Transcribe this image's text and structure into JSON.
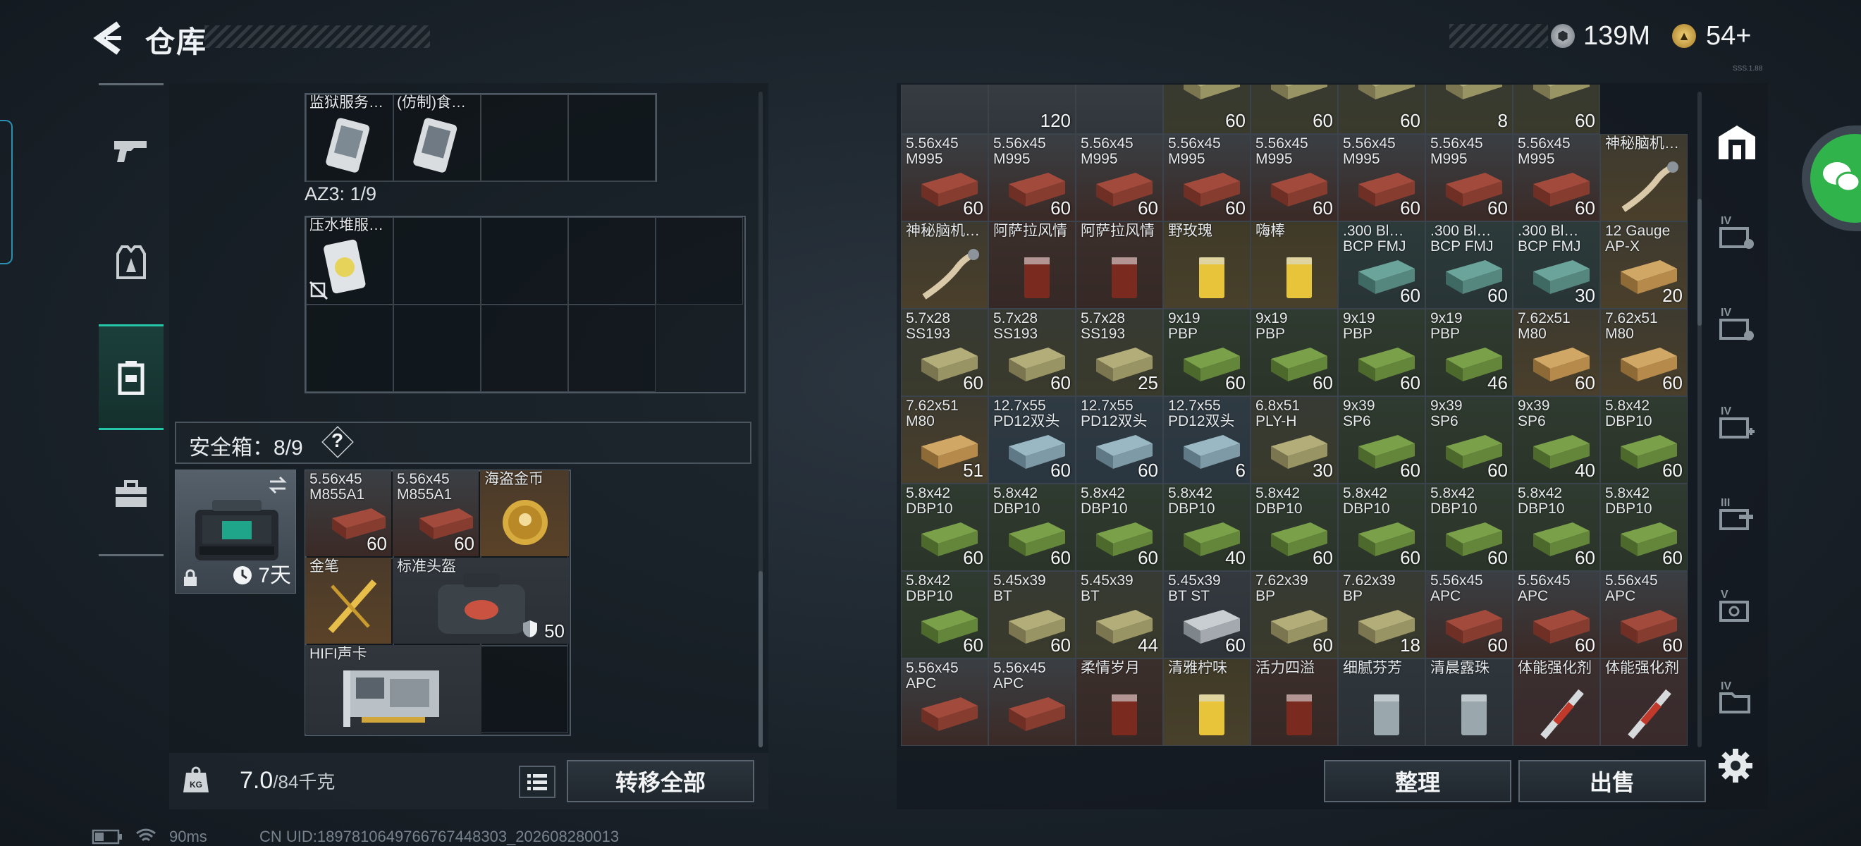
{
  "header": {
    "title": "仓库",
    "currency1": "139M",
    "currency2": "54+",
    "version": "SSS.1.88"
  },
  "left_panel": {
    "containers": [
      {
        "name": "",
        "items": [
          {
            "name": "监狱服务…",
            "count": ""
          },
          {
            "name": "(仿制)食…",
            "count": ""
          }
        ]
      },
      {
        "name": "AZ3: 1/9",
        "items": [
          {
            "name": "压水堆服…",
            "count": ""
          }
        ]
      }
    ],
    "safebox": {
      "label": "安全箱：8/9",
      "help": "?",
      "duration": "7天",
      "items": [
        {
          "name": "5.56x45 M855A1",
          "count": "60"
        },
        {
          "name": "5.56x45 M855A1",
          "count": "60"
        },
        {
          "name": "海盗金币",
          "count": ""
        },
        {
          "name": "金笔",
          "count": ""
        },
        {
          "name": "标准头盔",
          "count": "50"
        },
        {
          "name": "HIFI声卡",
          "count": ""
        }
      ]
    },
    "weight": "7.0",
    "weight_max": "/84千克",
    "weight_icon": "KG",
    "transfer_all": "转移全部"
  },
  "right_panel": {
    "top_row": [
      {
        "name": "",
        "count": ""
      },
      {
        "name": "",
        "count": "120"
      },
      {
        "name": "",
        "count": ""
      },
      {
        "name": "",
        "count": "60"
      },
      {
        "name": "",
        "count": "60"
      },
      {
        "name": "",
        "count": "60"
      },
      {
        "name": "",
        "count": "8"
      },
      {
        "name": "",
        "count": "60"
      }
    ],
    "rows": [
      [
        {
          "name": "5.56x45\nM995",
          "count": "60",
          "type": "ammo-red"
        },
        {
          "name": "5.56x45\nM995",
          "count": "60",
          "type": "ammo-red"
        },
        {
          "name": "5.56x45\nM995",
          "count": "60",
          "type": "ammo-red"
        },
        {
          "name": "5.56x45\nM995",
          "count": "60",
          "type": "ammo-red"
        },
        {
          "name": "5.56x45\nM995",
          "count": "60",
          "type": "ammo-red"
        },
        {
          "name": "5.56x45\nM995",
          "count": "60",
          "type": "ammo-red"
        },
        {
          "name": "5.56x45\nM995",
          "count": "60",
          "type": "ammo-red"
        },
        {
          "name": "5.56x45\nM995",
          "count": "60",
          "type": "ammo-red"
        },
        {
          "name": "神秘脑机…",
          "count": "",
          "type": "cable"
        }
      ],
      [
        {
          "name": "神秘脑机…",
          "count": "",
          "type": "cable"
        },
        {
          "name": "阿萨拉风情",
          "count": "",
          "type": "drink-dark"
        },
        {
          "name": "阿萨拉风情",
          "count": "",
          "type": "drink-dark"
        },
        {
          "name": "野玫瑰",
          "count": "",
          "type": "drink-yellow"
        },
        {
          "name": "嗨棒",
          "count": "",
          "type": "drink-yellow"
        },
        {
          "name": ".300 Bl…\nBCP FMJ",
          "count": "60",
          "type": "ammo-teal"
        },
        {
          "name": ".300 Bl…\nBCP FMJ",
          "count": "60",
          "type": "ammo-teal"
        },
        {
          "name": ".300 Bl…\nBCP FMJ",
          "count": "30",
          "type": "ammo-teal"
        },
        {
          "name": "12 Gauge\nAP-X",
          "count": "20",
          "type": "ammo-tan"
        }
      ],
      [
        {
          "name": "5.7x28\nSS193",
          "count": "60",
          "type": "ammo-olive"
        },
        {
          "name": "5.7x28\nSS193",
          "count": "60",
          "type": "ammo-olive"
        },
        {
          "name": "5.7x28\nSS193",
          "count": "25",
          "type": "ammo-olive"
        },
        {
          "name": "9x19\nPBP",
          "count": "60",
          "type": "ammo-green"
        },
        {
          "name": "9x19\nPBP",
          "count": "60",
          "type": "ammo-green"
        },
        {
          "name": "9x19\nPBP",
          "count": "60",
          "type": "ammo-green"
        },
        {
          "name": "9x19\nPBP",
          "count": "46",
          "type": "ammo-green"
        },
        {
          "name": "7.62x51\nM80",
          "count": "60",
          "type": "ammo-tan"
        },
        {
          "name": "7.62x51\nM80",
          "count": "60",
          "type": "ammo-tan"
        }
      ],
      [
        {
          "name": "7.62x51\nM80",
          "count": "51",
          "type": "ammo-tan"
        },
        {
          "name": "12.7x55\nPD12双头",
          "count": "60",
          "type": "ammo-blue"
        },
        {
          "name": "12.7x55\nPD12双头",
          "count": "60",
          "type": "ammo-blue"
        },
        {
          "name": "12.7x55\nPD12双头",
          "count": "6",
          "type": "ammo-blue"
        },
        {
          "name": "6.8x51\nPLY-H",
          "count": "30",
          "type": "ammo-olive"
        },
        {
          "name": "9x39\nSP6",
          "count": "60",
          "type": "ammo-green"
        },
        {
          "name": "9x39\nSP6",
          "count": "60",
          "type": "ammo-green"
        },
        {
          "name": "9x39\nSP6",
          "count": "40",
          "type": "ammo-green"
        },
        {
          "name": "5.8x42\nDBP10",
          "count": "60",
          "type": "ammo-green"
        }
      ],
      [
        {
          "name": "5.8x42\nDBP10",
          "count": "60",
          "type": "ammo-green"
        },
        {
          "name": "5.8x42\nDBP10",
          "count": "60",
          "type": "ammo-green"
        },
        {
          "name": "5.8x42\nDBP10",
          "count": "60",
          "type": "ammo-green"
        },
        {
          "name": "5.8x42\nDBP10",
          "count": "40",
          "type": "ammo-green"
        },
        {
          "name": "5.8x42\nDBP10",
          "count": "60",
          "type": "ammo-green"
        },
        {
          "name": "5.8x42\nDBP10",
          "count": "60",
          "type": "ammo-green"
        },
        {
          "name": "5.8x42\nDBP10",
          "count": "60",
          "type": "ammo-green"
        },
        {
          "name": "5.8x42\nDBP10",
          "count": "60",
          "type": "ammo-green"
        },
        {
          "name": "5.8x42\nDBP10",
          "count": "60",
          "type": "ammo-green"
        }
      ],
      [
        {
          "name": "5.8x42\nDBP10",
          "count": "60",
          "type": "ammo-green"
        },
        {
          "name": "5.45x39\nBT",
          "count": "60",
          "type": "ammo-olive"
        },
        {
          "name": "5.45x39\nBT",
          "count": "44",
          "type": "ammo-olive"
        },
        {
          "name": "5.45x39\nBT ST",
          "count": "60",
          "type": "ammo-grey"
        },
        {
          "name": "7.62x39\nBP",
          "count": "60",
          "type": "ammo-olive"
        },
        {
          "name": "7.62x39\nBP",
          "count": "18",
          "type": "ammo-olive"
        },
        {
          "name": "5.56x45\nAPC",
          "count": "60",
          "type": "ammo-red"
        },
        {
          "name": "5.56x45\nAPC",
          "count": "60",
          "type": "ammo-red"
        },
        {
          "name": "5.56x45\nAPC",
          "count": "60",
          "type": "ammo-red"
        }
      ],
      [
        {
          "name": "5.56x45\nAPC",
          "count": "",
          "type": "ammo-red"
        },
        {
          "name": "5.56x45\nAPC",
          "count": "",
          "type": "ammo-red"
        },
        {
          "name": "柔情岁月",
          "count": "",
          "type": "drink-dark"
        },
        {
          "name": "清雅柠味",
          "count": "",
          "type": "drink-yellow"
        },
        {
          "name": "活力四溢",
          "count": "",
          "type": "drink-dark"
        },
        {
          "name": "细腻芬芳",
          "count": "",
          "type": "drink-clear"
        },
        {
          "name": "清晨露珠",
          "count": "",
          "type": "drink-clear"
        },
        {
          "name": "体能强化剂",
          "count": "",
          "type": "syringe"
        },
        {
          "name": "体能强化剂",
          "count": "",
          "type": "syringe"
        }
      ]
    ],
    "tabs": [
      "IV",
      "IV",
      "IV",
      "III",
      "V",
      "IV"
    ],
    "sort_button": "整理",
    "sell_button": "出售"
  },
  "footer": {
    "ping": "90ms",
    "uid": "CN UID:1897810649766767448303_202608280013"
  },
  "colors": {
    "accent": "#25c6a8",
    "ammo_red": "#8c3a30",
    "ammo_green": "#5b7a3a"
  }
}
